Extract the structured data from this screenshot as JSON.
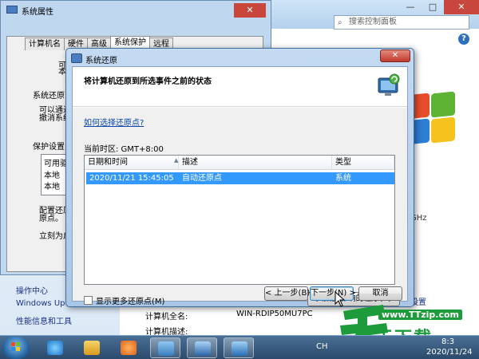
{
  "control_panel": {
    "search_placeholder": "搜索控制面板",
    "help_label": "?",
    "minimize": "—",
    "maximize": "□",
    "close": "✕",
    "see_also": [
      "操作中心",
      "Windows Update",
      "性能信息和工具"
    ],
    "ghz": "GHz",
    "settings_link": "设置",
    "computer_full_name_label": "计算机全名:",
    "computer_full_name_value": "WIN-RDIP50MU7PC",
    "computer_desc_label": "计算机描述:"
  },
  "system_properties": {
    "title": "系统属性",
    "tabs": [
      "计算机名",
      "硬件",
      "高级",
      "系统保护",
      "远程"
    ],
    "active_tab": "系统保护",
    "text_lines": [
      "可",
      "本",
      "系统还原",
      "可以通过",
      "撤消系统",
      "保护设置",
      "可用驱",
      "本地",
      "本地",
      "配置还原",
      "原点。",
      "立刻为启"
    ]
  },
  "system_restore": {
    "title": "系统还原",
    "close": "✕",
    "heading": "将计算机还原到所选事件之前的状态",
    "link": "如何选择还原点?",
    "timezone": "当前时区: GMT+8:00",
    "columns": [
      "日期和时间",
      "描述",
      "类型"
    ],
    "rows": [
      {
        "datetime": "2020/11/21 15:45:05",
        "description": "自动还原点",
        "type": "系统"
      }
    ],
    "show_more": "显示更多还原点(M)",
    "scan_button": "扫描受影响的程序(A)",
    "back_button": "< 上一步(B)",
    "next_button": "下一步(N) >",
    "cancel_button": "取消"
  },
  "watermark": {
    "url": "www.TTzip.com",
    "text": "天下载"
  },
  "taskbar": {
    "ime": "CH",
    "time": "8:3",
    "date": "2020/11/24"
  }
}
